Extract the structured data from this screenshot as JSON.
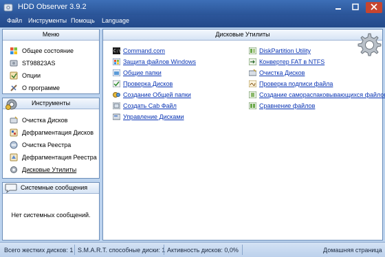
{
  "window": {
    "title": "HDD Observer 3.9.2"
  },
  "menubar": [
    "Файл",
    "Инструменты",
    "Помощь",
    "Language"
  ],
  "menu_panel": {
    "title": "Меню",
    "items": [
      {
        "label": "Общее состояние",
        "icon": "windows-logo-icon"
      },
      {
        "label": "ST98823AS",
        "icon": "hard-disk-icon"
      },
      {
        "label": "Опции",
        "icon": "options-icon"
      },
      {
        "label": "О программе",
        "icon": "about-icon"
      }
    ]
  },
  "tools_panel": {
    "title": "Инструменты",
    "items": [
      {
        "label": "Очистка Дисков",
        "icon": "disk-cleanup-icon"
      },
      {
        "label": "Дефрагментация Дисков",
        "icon": "defrag-icon"
      },
      {
        "label": "Очистка Реестра",
        "icon": "registry-clean-icon"
      },
      {
        "label": "Дефрагментация Реестра",
        "icon": "registry-defrag-icon"
      },
      {
        "label": "Дисковые Утилиты",
        "icon": "gear-icon"
      }
    ]
  },
  "messages_panel": {
    "title": "Системные сообщения",
    "text": "Нет системных сообщений."
  },
  "main": {
    "title": "Дисковые Утилиты",
    "left_links": [
      "Command.com",
      "Защита файлов Windows",
      "Общие папки",
      "Проверка Дисков",
      "Создание Общей папки",
      "Создать Cab Файл",
      "Управление Дисками"
    ],
    "right_links": [
      "DiskPartition Utility",
      "Конвертер FAT в NTFS",
      "Очистка Дисков",
      "Проверка подписи файла",
      "Создание самораспаковывающихся файлов",
      "Сравнение файлов"
    ]
  },
  "status": {
    "disks": "Всего жестких дисков: 1",
    "smart": "S.M.A.R.T. способные диски: 1",
    "activity": "Активность дисков: 0,0%",
    "home": "Домашняя страница"
  },
  "colors": {
    "link": "#0a35b4",
    "titlebar": "#2a5497",
    "panel_border": "#6b8db8"
  }
}
